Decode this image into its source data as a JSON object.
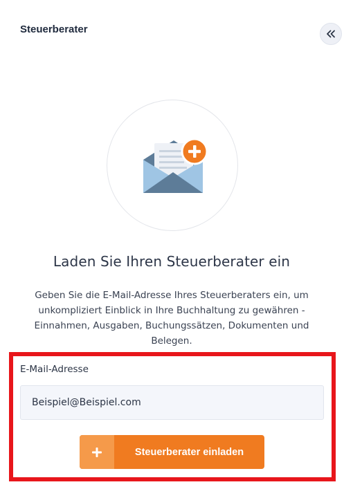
{
  "panel": {
    "title": "Steuerberater",
    "collapse_icon": "double-chevron-left-icon"
  },
  "illustration": {
    "icon": "envelope-plus-icon",
    "colors": {
      "envelope": "#5d7c98",
      "envelope_light": "#9fc5e4",
      "paper": "#eef1f6",
      "badge": "#f07b20"
    }
  },
  "main": {
    "heading": "Laden Sie Ihren Steuerberater ein",
    "description": "Geben Sie die E-Mail-Adresse Ihres Steuerberaters ein, um unkompliziert Einblick in Ihre Buchhaltung zu gewähren - Einnahmen, Ausgaben, Buchungssätzen, Dokumenten und Belegen."
  },
  "form": {
    "email_label": "E-Mail-Adresse",
    "email_value": "Beispiel@Beispiel.com",
    "invite_button_label": "Steuerberater einladen",
    "invite_button_icon": "plus-icon"
  },
  "colors": {
    "accent": "#f07b20",
    "accent_light": "#f59a4a",
    "highlight": "#e8161b"
  }
}
